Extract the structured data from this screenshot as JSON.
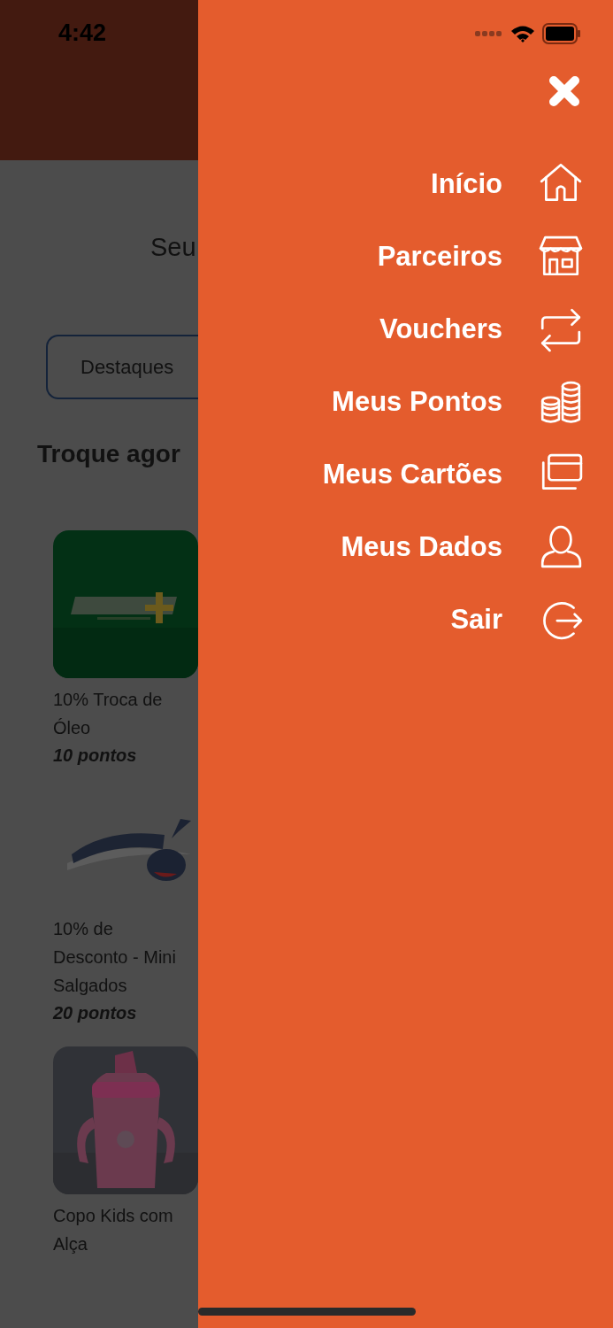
{
  "status_bar": {
    "time": "4:42"
  },
  "page": {
    "heading": "Seu",
    "filter_button": "Destaques",
    "section_title": "Troque agor",
    "products": [
      {
        "kind": "picture",
        "title": "10% Troca de Óleo",
        "points": "10 pontos"
      },
      {
        "kind": "picture",
        "title": "10% de Desconto - Mini Salgados",
        "points": "20 pontos"
      },
      {
        "kind": "picture",
        "title": "Copo Kids com Alça"
      }
    ]
  },
  "menu": {
    "items": [
      {
        "kind": "home",
        "label": "Início"
      },
      {
        "kind": "store",
        "label": "Parceiros"
      },
      {
        "kind": "swap",
        "label": "Vouchers"
      },
      {
        "kind": "coins",
        "label": "Meus Pontos"
      },
      {
        "kind": "cards",
        "label": "Meus Cartões"
      },
      {
        "kind": "user",
        "label": "Meus Dados"
      },
      {
        "kind": "logout",
        "label": "Sair"
      }
    ]
  }
}
